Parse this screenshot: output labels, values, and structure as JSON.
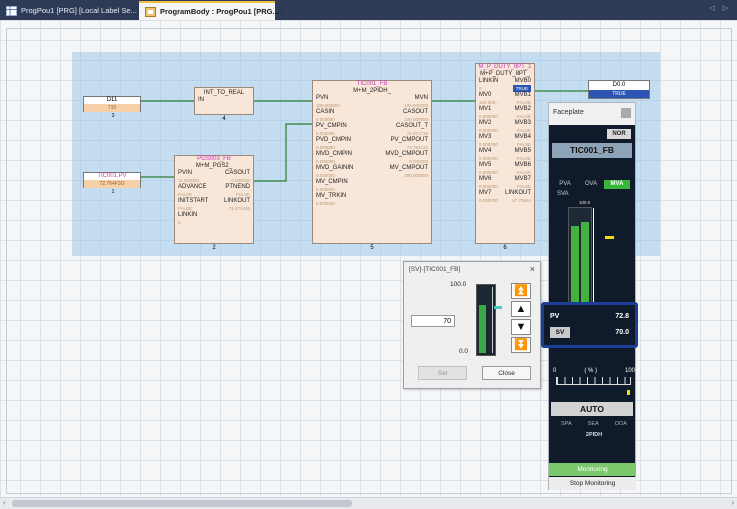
{
  "tabs": [
    {
      "label": "ProgPou1 [PRG] [Local Label Se...",
      "active": false
    },
    {
      "label": "ProgramBody : ProgPou1 [PRG...",
      "active": true
    }
  ],
  "variables": {
    "d1": {
      "name": "D11",
      "value": "710",
      "index": "3"
    },
    "tic_pv": {
      "name": "TIC001.PV",
      "value": "72.764F3O",
      "index": "1"
    },
    "d0": {
      "name": "D0.0",
      "value": "TRUE"
    }
  },
  "blocks": {
    "int_to_real": {
      "type": "INT_TO_REAL",
      "in": "IN",
      "num": "4"
    },
    "pgs": {
      "title": "PGS003_FB",
      "type": "M+M_PGS2_",
      "rows": [
        {
          "l": "PVIN",
          "r": "CASOUT"
        },
        {
          "l": "11.000000",
          "r": "0.000000",
          "v": true
        },
        {
          "l": "ADVANCE",
          "r": "PTNEND"
        },
        {
          "l": "FALSE",
          "r": "FALSE",
          "v": true
        },
        {
          "l": "INITSTART",
          "r": "LINKOUT"
        },
        {
          "l": "FALSE",
          "r": "71.871446",
          "v": true
        },
        {
          "l": "LINKIN",
          "r": ""
        },
        {
          "l": "0",
          "r": "",
          "v": true
        }
      ],
      "num": "2"
    },
    "tic": {
      "title": "TIC001_FB",
      "type": "M+M_2PIDH_",
      "rows": [
        {
          "l": "PVN",
          "r": "MVN"
        },
        {
          "l": "100.000000",
          "r": "100.000000",
          "v": true
        },
        {
          "l": "CASIN",
          "r": "CASOUT"
        },
        {
          "l": "0.000000",
          "r": "100.000000",
          "v": true
        },
        {
          "l": "PV_CMPIN",
          "r": "CASOUT_T"
        },
        {
          "l": "0.000000",
          "r": "71.871716",
          "v": true
        },
        {
          "l": "PVD_CMPIN",
          "r": "PV_CMPOUT"
        },
        {
          "l": "0.000000",
          "r": "72.764133",
          "v": true
        },
        {
          "l": "MVD_CMPIN",
          "r": "MVD_CMPOUT"
        },
        {
          "l": "0.000000",
          "r": "0.000000",
          "v": true
        },
        {
          "l": "MVD_GAININ",
          "r": "MV_CMPOUT"
        },
        {
          "l": "0.000000",
          "r": "300.000000",
          "v": true
        },
        {
          "l": "MV_CMPIN",
          "r": ""
        },
        {
          "l": "0.000000",
          "r": "",
          "v": true
        },
        {
          "l": "MV_TRKIN",
          "r": ""
        },
        {
          "l": "0.000000",
          "r": "",
          "v": true
        }
      ],
      "num": "5"
    },
    "duty": {
      "title": "M_P_DUTY_8PT_1",
      "type": "M+P_DUTY_8PT_",
      "rows": [
        {
          "l": "LINKIN",
          "r": "MVB0"
        },
        {
          "l": "0",
          "r": "TRUE",
          "v": true
        },
        {
          "l": "MV0",
          "r": "MVB1"
        },
        {
          "l": "100.000...",
          "r": "FALSE",
          "v": true
        },
        {
          "l": "MV1",
          "r": "MVB2"
        },
        {
          "l": "0.000000",
          "r": "FALSE",
          "v": true
        },
        {
          "l": "MV2",
          "r": "MVB3"
        },
        {
          "l": "0.000000",
          "r": "FALSE",
          "v": true
        },
        {
          "l": "MV3",
          "r": "MVB4"
        },
        {
          "l": "0.000000",
          "r": "FALSE",
          "v": true
        },
        {
          "l": "MV4",
          "r": "MVB5"
        },
        {
          "l": "0.000000",
          "r": "FALSE",
          "v": true
        },
        {
          "l": "MV5",
          "r": "MVB6"
        },
        {
          "l": "0.000000",
          "r": "FALSE",
          "v": true
        },
        {
          "l": "MV6",
          "r": "MVB7"
        },
        {
          "l": "0.000000",
          "r": "FALSE",
          "v": true
        },
        {
          "l": "MV7",
          "r": "LINKOUT"
        },
        {
          "l": "0.000000",
          "r": "87.70664",
          "v": true
        }
      ],
      "num": "6"
    }
  },
  "faceplate": {
    "header": "Faceplate",
    "nor": "NOR",
    "tag": "TIC001_FB",
    "modes": [
      "PVA",
      "OVA",
      "MVA"
    ],
    "sva": "SVA",
    "bar_top": "100.0",
    "pv_label": "PV",
    "pv_value": "72.8",
    "sv_label": "SV",
    "sv_value": "70.0",
    "mv_scale": [
      "0",
      "( % )",
      "100"
    ],
    "mode_button": "AUTO",
    "alarm_labels": [
      "SPA",
      "SEA",
      "OOA"
    ],
    "algorithm": "2PIDH",
    "monitoring": "Monitoring",
    "stop_monitoring": "Stop Monitoring"
  },
  "sv_dialog": {
    "title": "[SV]-[TIC001_FB]",
    "close_x": "×",
    "top": "100.0",
    "bottom": "0.0",
    "value": "70",
    "set": "Set",
    "close": "Close"
  },
  "colors": {
    "accent": "#2d3b57",
    "highlight": "#1c3f9a",
    "monitor": "#7cc86c"
  }
}
